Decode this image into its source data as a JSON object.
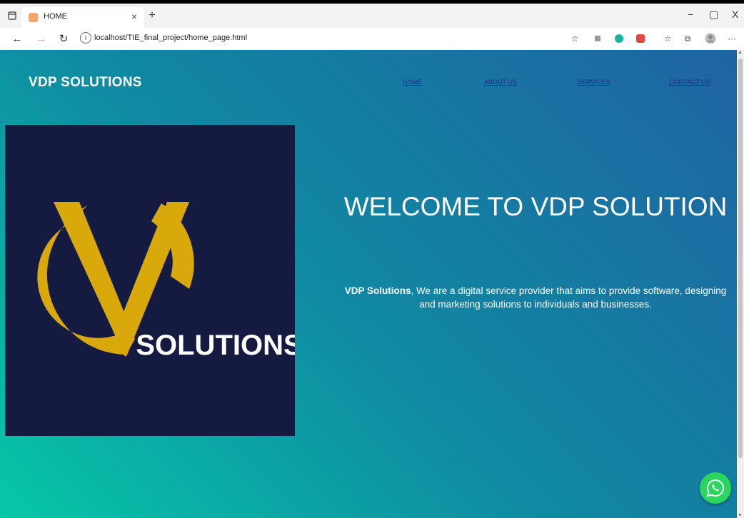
{
  "browser": {
    "tab_title": "HOME",
    "tab_close": "×",
    "new_tab": "+",
    "url": "localhost/TIE_final_project/home_page.html",
    "controls": {
      "minimize": "−",
      "maximize": "▢",
      "close": "X"
    },
    "menu": "···"
  },
  "site": {
    "brand": "VDP SOLUTIONS",
    "nav": [
      {
        "label": "HOME"
      },
      {
        "label": "ABOUT US"
      },
      {
        "label": "SERVICES"
      },
      {
        "label": "CONTACT US"
      }
    ],
    "logo_text": "SOLUTIONS",
    "welcome_title": "WELCOME TO VDP SOLUTION",
    "description_bold": "VDP Solutions",
    "description_rest": ", We are a digital service provider that aims to provide software, designing and marketing solutions to individuals and businesses."
  },
  "colors": {
    "logo_background": "#151b40",
    "logo_gold": "#d9a80a",
    "gradient_start": "#06c7a8",
    "gradient_end": "#1f63a2",
    "whatsapp": "#2bd65e"
  }
}
